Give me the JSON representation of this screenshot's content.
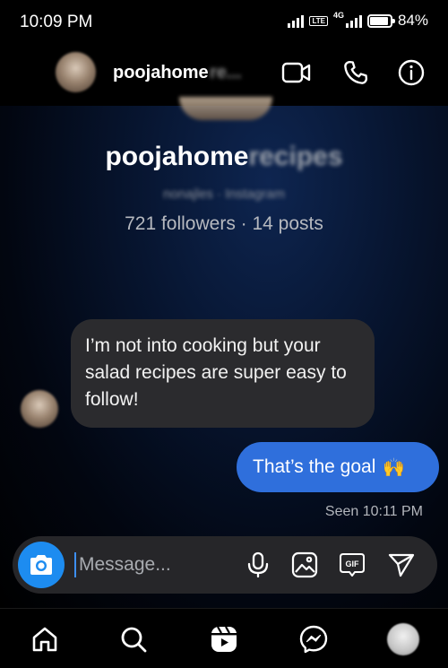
{
  "status_bar": {
    "time": "10:09 PM",
    "network_type": "4G",
    "lte_label": "LTE",
    "battery_percent": "84%",
    "battery_level": 0.84
  },
  "header": {
    "name_visible": "poojahome",
    "name_obscured": "re...",
    "icons": [
      "video-call-icon",
      "phone-icon",
      "info-icon"
    ]
  },
  "profile": {
    "name_visible": "poojahome",
    "name_obscured": "recipes",
    "subtitle_obscured": "nonajles · Instagram",
    "stats": "721 followers · 14 posts"
  },
  "messages": [
    {
      "direction": "incoming",
      "text": "I’m not into cooking but your salad recipes are super easy to follow!"
    },
    {
      "direction": "outgoing",
      "text": "That’s the goal",
      "emoji": "🙌"
    }
  ],
  "seen_text": "Seen 10:11 PM",
  "composer": {
    "placeholder": "Message...",
    "icons": [
      "camera-icon",
      "microphone-icon",
      "gallery-icon",
      "gif-icon",
      "send-icon"
    ],
    "gif_label": "GIF"
  },
  "bottom_nav": {
    "items": [
      "home-icon",
      "search-icon",
      "reels-icon",
      "messenger-icon",
      "profile-avatar"
    ]
  },
  "colors": {
    "accent_blue": "#1d8cf0",
    "outgoing_bubble": "#2f6fdc",
    "incoming_bubble": "#2b2b2e"
  }
}
